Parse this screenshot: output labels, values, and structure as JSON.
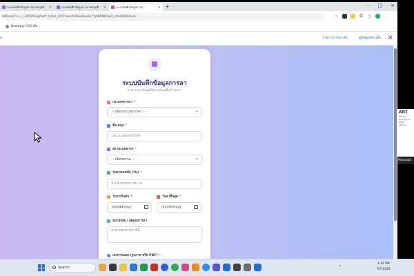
{
  "browser": {
    "tabs": [
      {
        "label": "ระบบบันทึกข้อมูลการลายอนุมัติ"
      },
      {
        "label": "ระบบบันทึกข้อมูลการลายอนุมัติ"
      },
      {
        "label": "ระบบบันทึกข้อมูลการลา"
      }
    ],
    "url": "AKfycbzTvr_L_u3RQfGsgZaVY_tcRrz_cHfz7wmTelWoeKuwbl7TyMWNRGp8_rdm8I0Dt/exec",
    "new_tab": "+",
    "window_controls": [
      "–",
      "□",
      "×"
    ],
    "bookmark": "Nodequy G43 We..."
  },
  "page": {
    "nav_left": "e",
    "nav_links": [
      "รายการการลาเลิม",
      "คู่มือดูเบติลาเลิ้ม"
    ],
    "close": "×"
  },
  "form": {
    "title": "ระบบบันทึกข้อมูลการลา",
    "subtitle": "กรุณากรอกข้อมูลให้ครบถ้วนเพื่อทำรับการ",
    "leave_type": {
      "label": "ประเภทการลา",
      "required": "*",
      "value": "-- เลือกประเภทการลา --"
    },
    "name": {
      "label": "ชื่อ-สกุล",
      "required": "*",
      "placeholder": "เช่น นายสมชาย ใจดี"
    },
    "status": {
      "label": "สถานะบุคลากร",
      "required": "*",
      "value": "-- เลือกสถานะ --"
    },
    "days": {
      "label": "วันลาคงเหลือ (วัน)",
      "required": "*",
      "placeholder": "ระบุจำนวนวัน เช่น 10"
    },
    "start_date": {
      "label": "วันลาเริ่มต้น",
      "required": "*",
      "value": "mm/dd/yyyy"
    },
    "end_date": {
      "label": "วันลาสิ้นสุด",
      "required": "*",
      "value": "mm/dd/yyyy"
    },
    "reason": {
      "label": "หมายเหตุ / เหตุผลการลา",
      "placeholder": "ระบุเหตุผลการลาที่นี่..."
    },
    "attachment": {
      "label": "เอกสารแนบ (รูปภาพ หรือ PDF)",
      "required": "*"
    }
  },
  "taskbar": {
    "search_label": "Search",
    "tray": "^",
    "time": "4:16 PM",
    "date": "9/7/2026"
  },
  "side_video": {
    "brand": "ART",
    "caption": "Online Training for Public Library...",
    "name": "Panpapo"
  },
  "colors": {
    "accent_purple": "#9b6bea",
    "title_purple": "#3b2a78",
    "link_blue": "#3a5fd6",
    "required_red": "#e04848"
  }
}
